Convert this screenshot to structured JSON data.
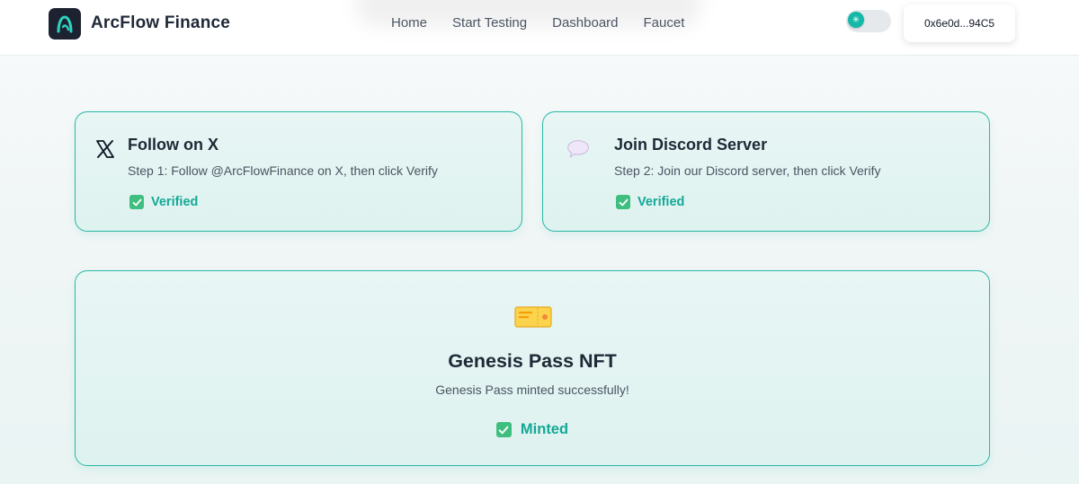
{
  "header": {
    "brand": "ArcFlow Finance",
    "nav": [
      {
        "label": "Home"
      },
      {
        "label": "Start Testing"
      },
      {
        "label": "Dashboard"
      },
      {
        "label": "Faucet"
      }
    ],
    "wallet_address": "0x6e0d...94C5"
  },
  "tasks": [
    {
      "icon": "x-logo-icon",
      "title": "Follow on X",
      "description": "Step 1: Follow @ArcFlowFinance on X, then click Verify",
      "status": "Verified"
    },
    {
      "icon": "speech-bubble-icon",
      "title": "Join Discord Server",
      "description": "Step 2: Join our Discord server, then click Verify",
      "status": "Verified"
    }
  ],
  "nft": {
    "icon": "ticket-icon",
    "title": "Genesis Pass NFT",
    "description": "Genesis Pass minted successfully!",
    "status": "Minted"
  },
  "colors": {
    "accent": "#14b8a6",
    "card_border": "#2ab7a5",
    "check_green": "#3fbf7f",
    "logo_tile": "#1c2230"
  }
}
